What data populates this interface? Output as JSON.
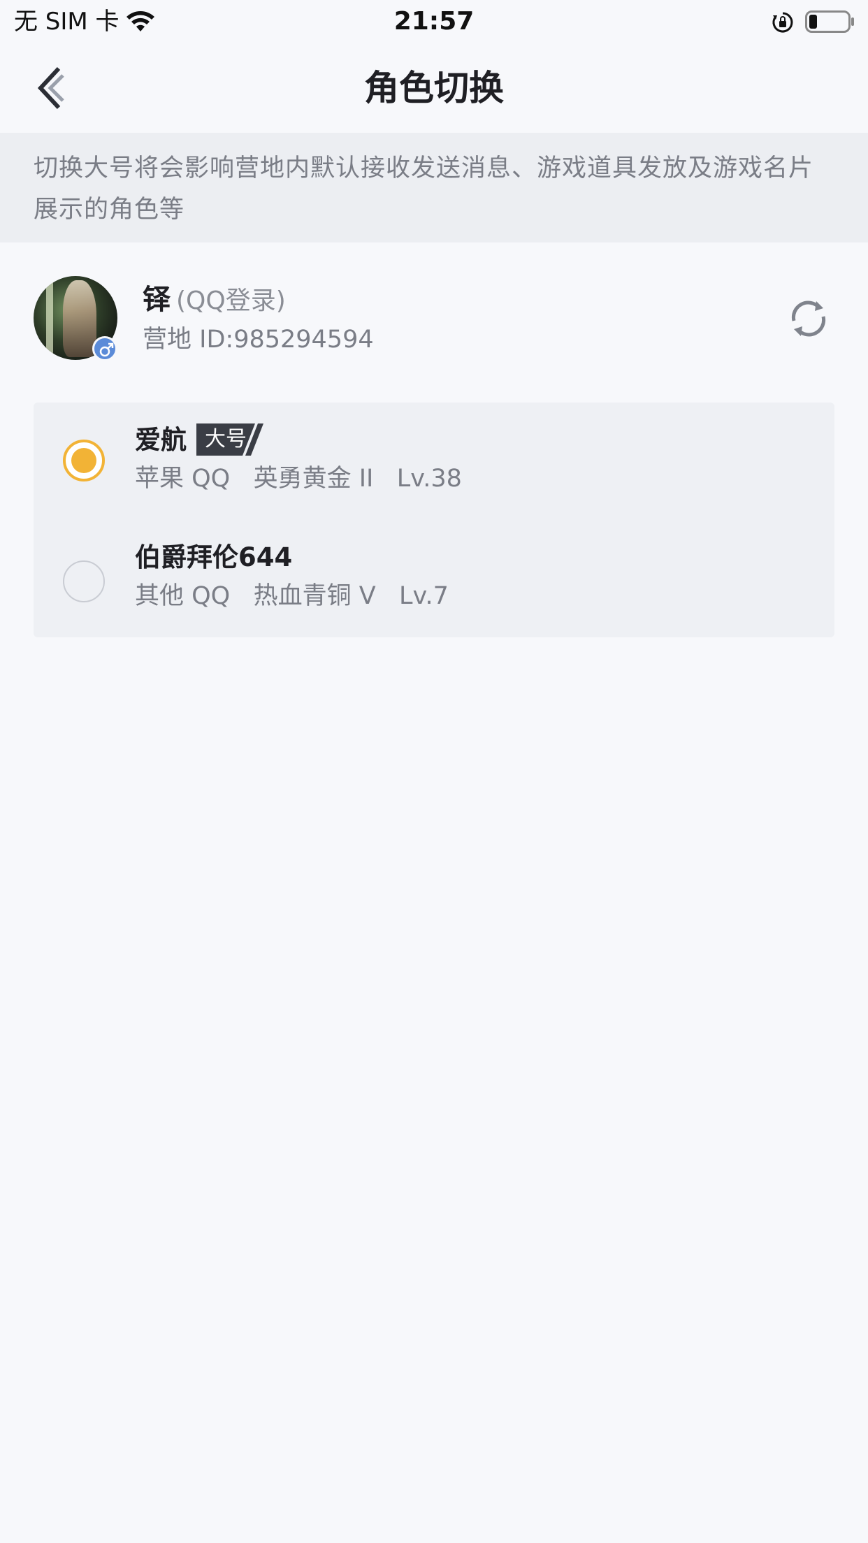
{
  "status_bar": {
    "carrier": "无 SIM 卡",
    "time": "21:57",
    "battery_level": 0.2
  },
  "nav": {
    "title": "角色切换",
    "back_icon": "chevron-left-icon"
  },
  "notice": {
    "line1": "切换大号将会影响营地内默认接收发送消息、游戏道具发放及游戏名片",
    "line2": "展示的角色等"
  },
  "account": {
    "name": "铎",
    "login_type": "(QQ登录)",
    "camp_id": "营地 ID:985294594",
    "gender_icon": "male-icon",
    "refresh_icon": "refresh-icon"
  },
  "roles": [
    {
      "name": "爱航",
      "tag": "大号",
      "detail": "苹果 QQ   英勇黄金 II   Lv.38",
      "selected": true
    },
    {
      "name": "伯爵拜伦644",
      "detail": "其他 QQ   热血青铜 V   Lv.7",
      "selected": false
    }
  ],
  "colors": {
    "accent": "#f2b336",
    "tag_bg": "#3a3d45",
    "background": "#f7f8fb",
    "notice_bg": "#eceef2"
  }
}
